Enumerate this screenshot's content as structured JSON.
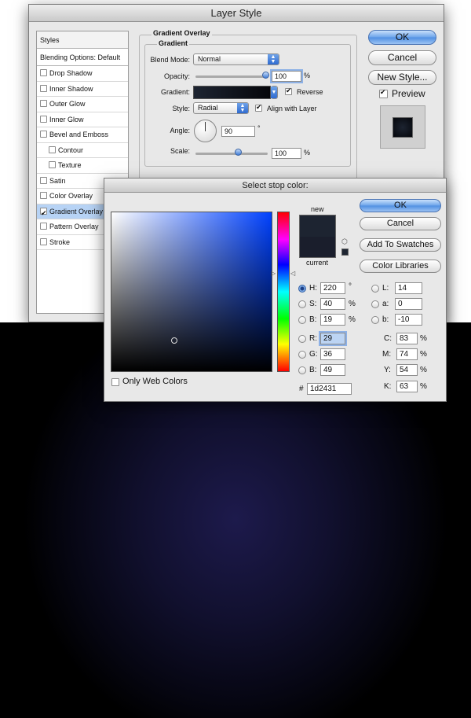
{
  "layer_style": {
    "title": "Layer Style",
    "styles_header": "Styles",
    "blending_options": "Blending Options: Default",
    "effects": [
      {
        "label": "Drop Shadow",
        "checked": false,
        "sub": false
      },
      {
        "label": "Inner Shadow",
        "checked": false,
        "sub": false
      },
      {
        "label": "Outer Glow",
        "checked": false,
        "sub": false
      },
      {
        "label": "Inner Glow",
        "checked": false,
        "sub": false
      },
      {
        "label": "Bevel and Emboss",
        "checked": false,
        "sub": false
      },
      {
        "label": "Contour",
        "checked": false,
        "sub": true
      },
      {
        "label": "Texture",
        "checked": false,
        "sub": true
      },
      {
        "label": "Satin",
        "checked": false,
        "sub": false
      },
      {
        "label": "Color Overlay",
        "checked": false,
        "sub": false
      },
      {
        "label": "Gradient Overlay",
        "checked": true,
        "sub": false,
        "selected": true
      },
      {
        "label": "Pattern Overlay",
        "checked": false,
        "sub": false
      },
      {
        "label": "Stroke",
        "checked": false,
        "sub": false
      }
    ],
    "section_title": "Gradient Overlay",
    "group_title": "Gradient",
    "blend_mode_label": "Blend Mode:",
    "blend_mode_value": "Normal",
    "opacity_label": "Opacity:",
    "opacity_value": "100",
    "opacity_unit": "%",
    "gradient_label": "Gradient:",
    "reverse_label": "Reverse",
    "style_label": "Style:",
    "style_value": "Radial",
    "align_label": "Align with Layer",
    "angle_label": "Angle:",
    "angle_value": "90",
    "angle_unit": "°",
    "scale_label": "Scale:",
    "scale_value": "100",
    "scale_unit": "%",
    "ok": "OK",
    "cancel": "Cancel",
    "new_style": "New Style...",
    "preview": "Preview"
  },
  "color_picker": {
    "title": "Select stop color:",
    "new_label": "new",
    "current_label": "current",
    "ok": "OK",
    "cancel": "Cancel",
    "add_to_swatches": "Add To Swatches",
    "color_libraries": "Color Libraries",
    "only_web_colors": "Only Web Colors",
    "hsb": [
      {
        "label": "H:",
        "value": "220",
        "unit": "°",
        "selected": true
      },
      {
        "label": "S:",
        "value": "40",
        "unit": "%",
        "selected": false
      },
      {
        "label": "B:",
        "value": "19",
        "unit": "%",
        "selected": false
      }
    ],
    "rgb": [
      {
        "label": "R:",
        "value": "29"
      },
      {
        "label": "G:",
        "value": "36"
      },
      {
        "label": "B:",
        "value": "49"
      }
    ],
    "lab": [
      {
        "label": "L:",
        "value": "14"
      },
      {
        "label": "a:",
        "value": "0"
      },
      {
        "label": "b:",
        "value": "-10"
      }
    ],
    "cmyk": [
      {
        "label": "C:",
        "value": "83",
        "unit": "%"
      },
      {
        "label": "M:",
        "value": "74",
        "unit": "%"
      },
      {
        "label": "Y:",
        "value": "54",
        "unit": "%"
      },
      {
        "label": "K:",
        "value": "63",
        "unit": "%"
      }
    ],
    "hex_label": "#",
    "hex_value": "1d2431"
  },
  "colors": {
    "new_color": "#1d2431",
    "current_color": "#1a1e2c",
    "hue_color": "#0041ff",
    "accent": "#4f8fe2"
  }
}
